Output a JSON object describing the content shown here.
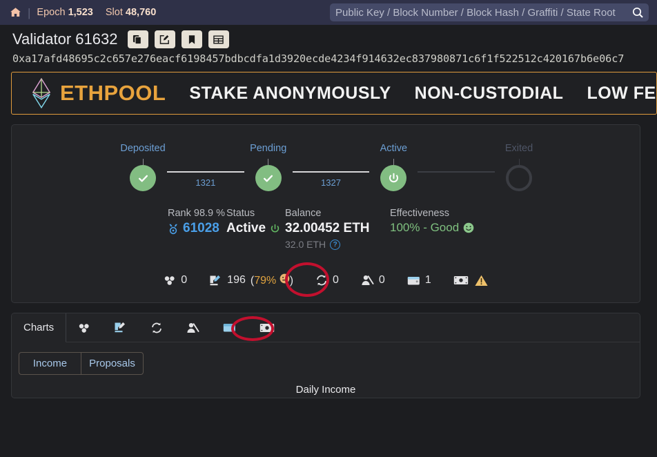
{
  "navbar": {
    "home_icon": "home-icon",
    "epoch_label": "Epoch",
    "epoch_value": "1,523",
    "slot_label": "Slot",
    "slot_value": "48,760",
    "search_placeholder": "Public Key / Block Number / Block Hash / Graffiti / State Root",
    "search_value": "",
    "search_icon": "search-icon"
  },
  "header": {
    "title": "Validator 61632",
    "actions": [
      {
        "name": "copy-button",
        "icon": "copy-icon"
      },
      {
        "name": "edit-button",
        "icon": "pencil-square-icon"
      },
      {
        "name": "bookmark-button",
        "icon": "bookmark-icon"
      },
      {
        "name": "table-button",
        "icon": "table-icon"
      }
    ],
    "pubkey": "0xa17afd48695c2c657e276eacf6198457bdbcdfa1d3920ecde4234f914632ec837980871c6f1f522512c420167b6e06c7"
  },
  "ad_banner": {
    "logo_icon": "ethereum-diamond-icon",
    "brand": "ETHPOOL",
    "slogans": [
      "STAKE ANONYMOUSLY",
      "NON-CUSTODIAL",
      "LOW FEES"
    ],
    "border_color": "#e09b3d",
    "brand_color": "#e8a33d"
  },
  "timeline": {
    "nodes": [
      {
        "label": "Deposited",
        "state": "done",
        "icon": "check-icon"
      },
      {
        "label": "Pending",
        "state": "done",
        "icon": "check-icon"
      },
      {
        "label": "Active",
        "state": "done",
        "icon": "power-icon"
      },
      {
        "label": "Exited",
        "state": "inactive",
        "icon": "empty-circle-icon"
      }
    ],
    "connectors": [
      "1321",
      "1327",
      ""
    ]
  },
  "summary": {
    "rank": {
      "head": "Rank 98.9 %",
      "icon": "medal-icon",
      "value": "61028"
    },
    "status": {
      "head": "Status",
      "value": "Active",
      "icon": "power-icon"
    },
    "balance": {
      "head": "Balance",
      "value": "32.00452 ETH",
      "sub": "32.0 ETH",
      "help_icon": "question-circle-icon"
    },
    "effectiveness": {
      "head": "Effectiveness",
      "value": "100% - Good",
      "icon": "smiley-good-icon"
    }
  },
  "icon_stats": [
    {
      "name": "blocks",
      "icon": "cubes-icon",
      "value": "0",
      "extra": ""
    },
    {
      "name": "attestations",
      "icon": "attestation-icon",
      "value": "196",
      "extra": "(79% 😐)",
      "extra_pct": "79%"
    },
    {
      "name": "sync-committee",
      "icon": "sync-icon",
      "value": "0",
      "extra": ""
    },
    {
      "name": "slashings",
      "icon": "slashing-icon",
      "value": "0",
      "extra": ""
    },
    {
      "name": "deposits",
      "icon": "wallet-icon",
      "value": "1",
      "extra": ""
    },
    {
      "name": "withdrawals",
      "icon": "money-icon",
      "value": "",
      "extra": "",
      "warning_icon": "warning-triangle-icon"
    }
  ],
  "annotations": {
    "color": "#c2102e",
    "shapes": [
      "ellipse-around-withdrawals-stat",
      "ellipse-around-withdrawals-tab"
    ]
  },
  "lower_panel": {
    "tabs": [
      {
        "label": "Charts",
        "icon": "",
        "active": true
      },
      {
        "label": "",
        "icon": "cubes-icon",
        "active": false
      },
      {
        "label": "",
        "icon": "attestation-icon",
        "active": false
      },
      {
        "label": "",
        "icon": "sync-icon",
        "active": false
      },
      {
        "label": "",
        "icon": "slashing-icon",
        "active": false
      },
      {
        "label": "",
        "icon": "wallet-icon",
        "active": false
      },
      {
        "label": "",
        "icon": "money-icon",
        "active": false
      }
    ],
    "button_group": [
      "Income",
      "Proposals"
    ],
    "chart_title": "Daily Income"
  }
}
